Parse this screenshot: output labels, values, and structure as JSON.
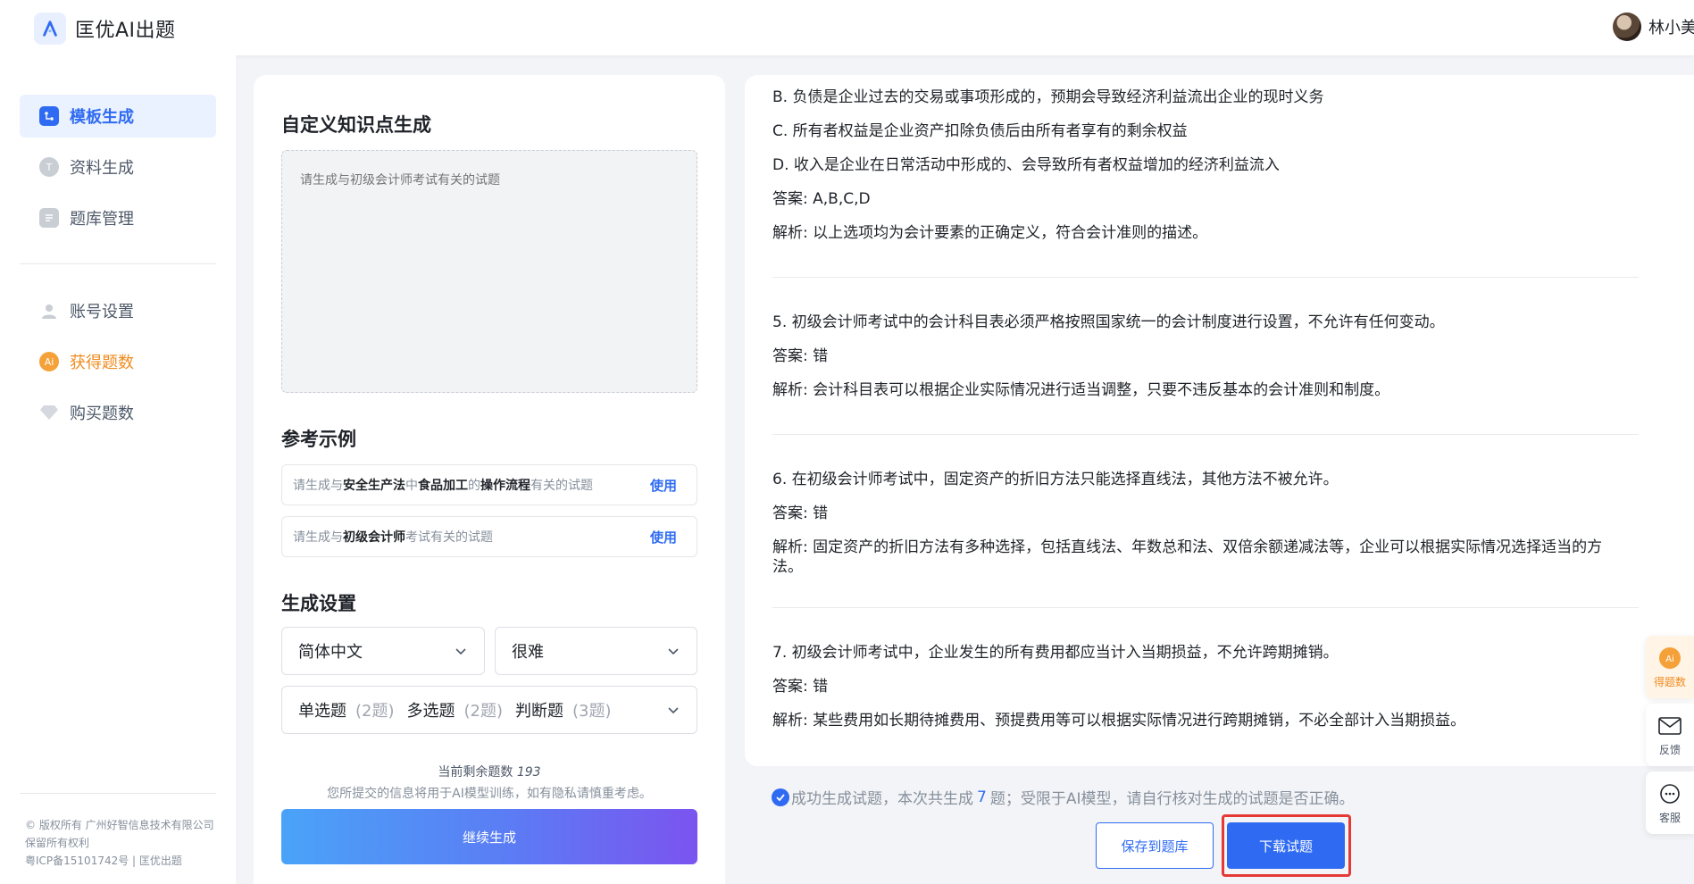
{
  "header": {
    "brand": "匡优AI出题",
    "user_name": "林小美"
  },
  "sidebar": {
    "items": [
      {
        "label": "模板生成",
        "icon": "template-icon",
        "active": true
      },
      {
        "label": "资料生成",
        "icon": "document-icon"
      },
      {
        "label": "题库管理",
        "icon": "question-bank-icon"
      },
      {
        "label": "账号设置",
        "icon": "user-icon"
      },
      {
        "label": "获得题数",
        "icon": "ai-coin-icon"
      },
      {
        "label": "购买题数",
        "icon": "diamond-icon"
      }
    ],
    "footer": [
      "© 版权所有 广州好智信息技术有限公司",
      "保留所有权利",
      "粤ICP备15101742号 | 匡优出题"
    ]
  },
  "left_panel": {
    "custom_title": "自定义知识点生成",
    "prompt_placeholder": "请生成与初级会计师考试有关的试题",
    "examples_title": "参考示例",
    "examples": [
      {
        "parts": [
          "请生成与",
          "安全生产法",
          "中",
          "食品加工",
          "的",
          "操作流程",
          "有关的试题"
        ],
        "use": "使用"
      },
      {
        "parts": [
          "请生成与",
          "初级会计师",
          "考试有关的试题"
        ],
        "use": "使用"
      }
    ],
    "settings_title": "生成设置",
    "language": "简体中文",
    "difficulty": "很难",
    "types": [
      {
        "name": "单选题",
        "count": "(2题)"
      },
      {
        "name": "多选题",
        "count": "(2题)"
      },
      {
        "name": "判断题",
        "count": "(3题)"
      }
    ],
    "remain_label": "当前剩余题数",
    "remain_count": "193",
    "notice": "您所提交的信息将用于AI模型训练，如有隐私请慎重考虑。",
    "generate_button": "继续生成"
  },
  "results": {
    "lines": [
      "B. 负债是企业过去的交易或事项形成的，预期会导致经济利益流出企业的现时义务",
      "C. 所有者权益是企业资产扣除负债后由所有者享有的剩余权益",
      "D. 收入是企业在日常活动中形成的、会导致所有者权益增加的经济利益流入",
      "答案: A,B,C,D",
      "解析: 以上选项均为会计要素的正确定义，符合会计准则的描述。",
      "5. 初级会计师考试中的会计科目表必须严格按照国家统一的会计制度进行设置，不允许有任何变动。",
      "答案: 错",
      "解析: 会计科目表可以根据企业实际情况进行适当调整，只要不违反基本的会计准则和制度。",
      "6. 在初级会计师考试中，固定资产的折旧方法只能选择直线法，其他方法不被允许。",
      "答案: 错",
      "解析: 固定资产的折旧方法有多种选择，包括直线法、年数总和法、双倍余额递减法等，企业可以根据实际情况选择适当的方法。",
      "7. 初级会计师考试中，企业发生的所有费用都应当计入当期损益，不允许跨期摊销。",
      "答案: 错",
      "解析: 某些费用如长期待摊费用、预提费用等可以根据实际情况进行跨期摊销，不必全部计入当期损益。"
    ],
    "status_prefix": "成功生成试题，本次共生成",
    "status_count": "7",
    "status_suffix": "题；受限于AI模型，请自行核对生成的试题是否正确。",
    "save_button": "保存到题库",
    "download_button": "下载试题"
  },
  "float_bar": {
    "points": "得题数",
    "feedback": "反馈",
    "service": "客服",
    "ai_badge": "Ai"
  },
  "colors": {
    "primary": "#2f6bf2",
    "highlight": "#e53935",
    "orange": "#f08b1f"
  }
}
